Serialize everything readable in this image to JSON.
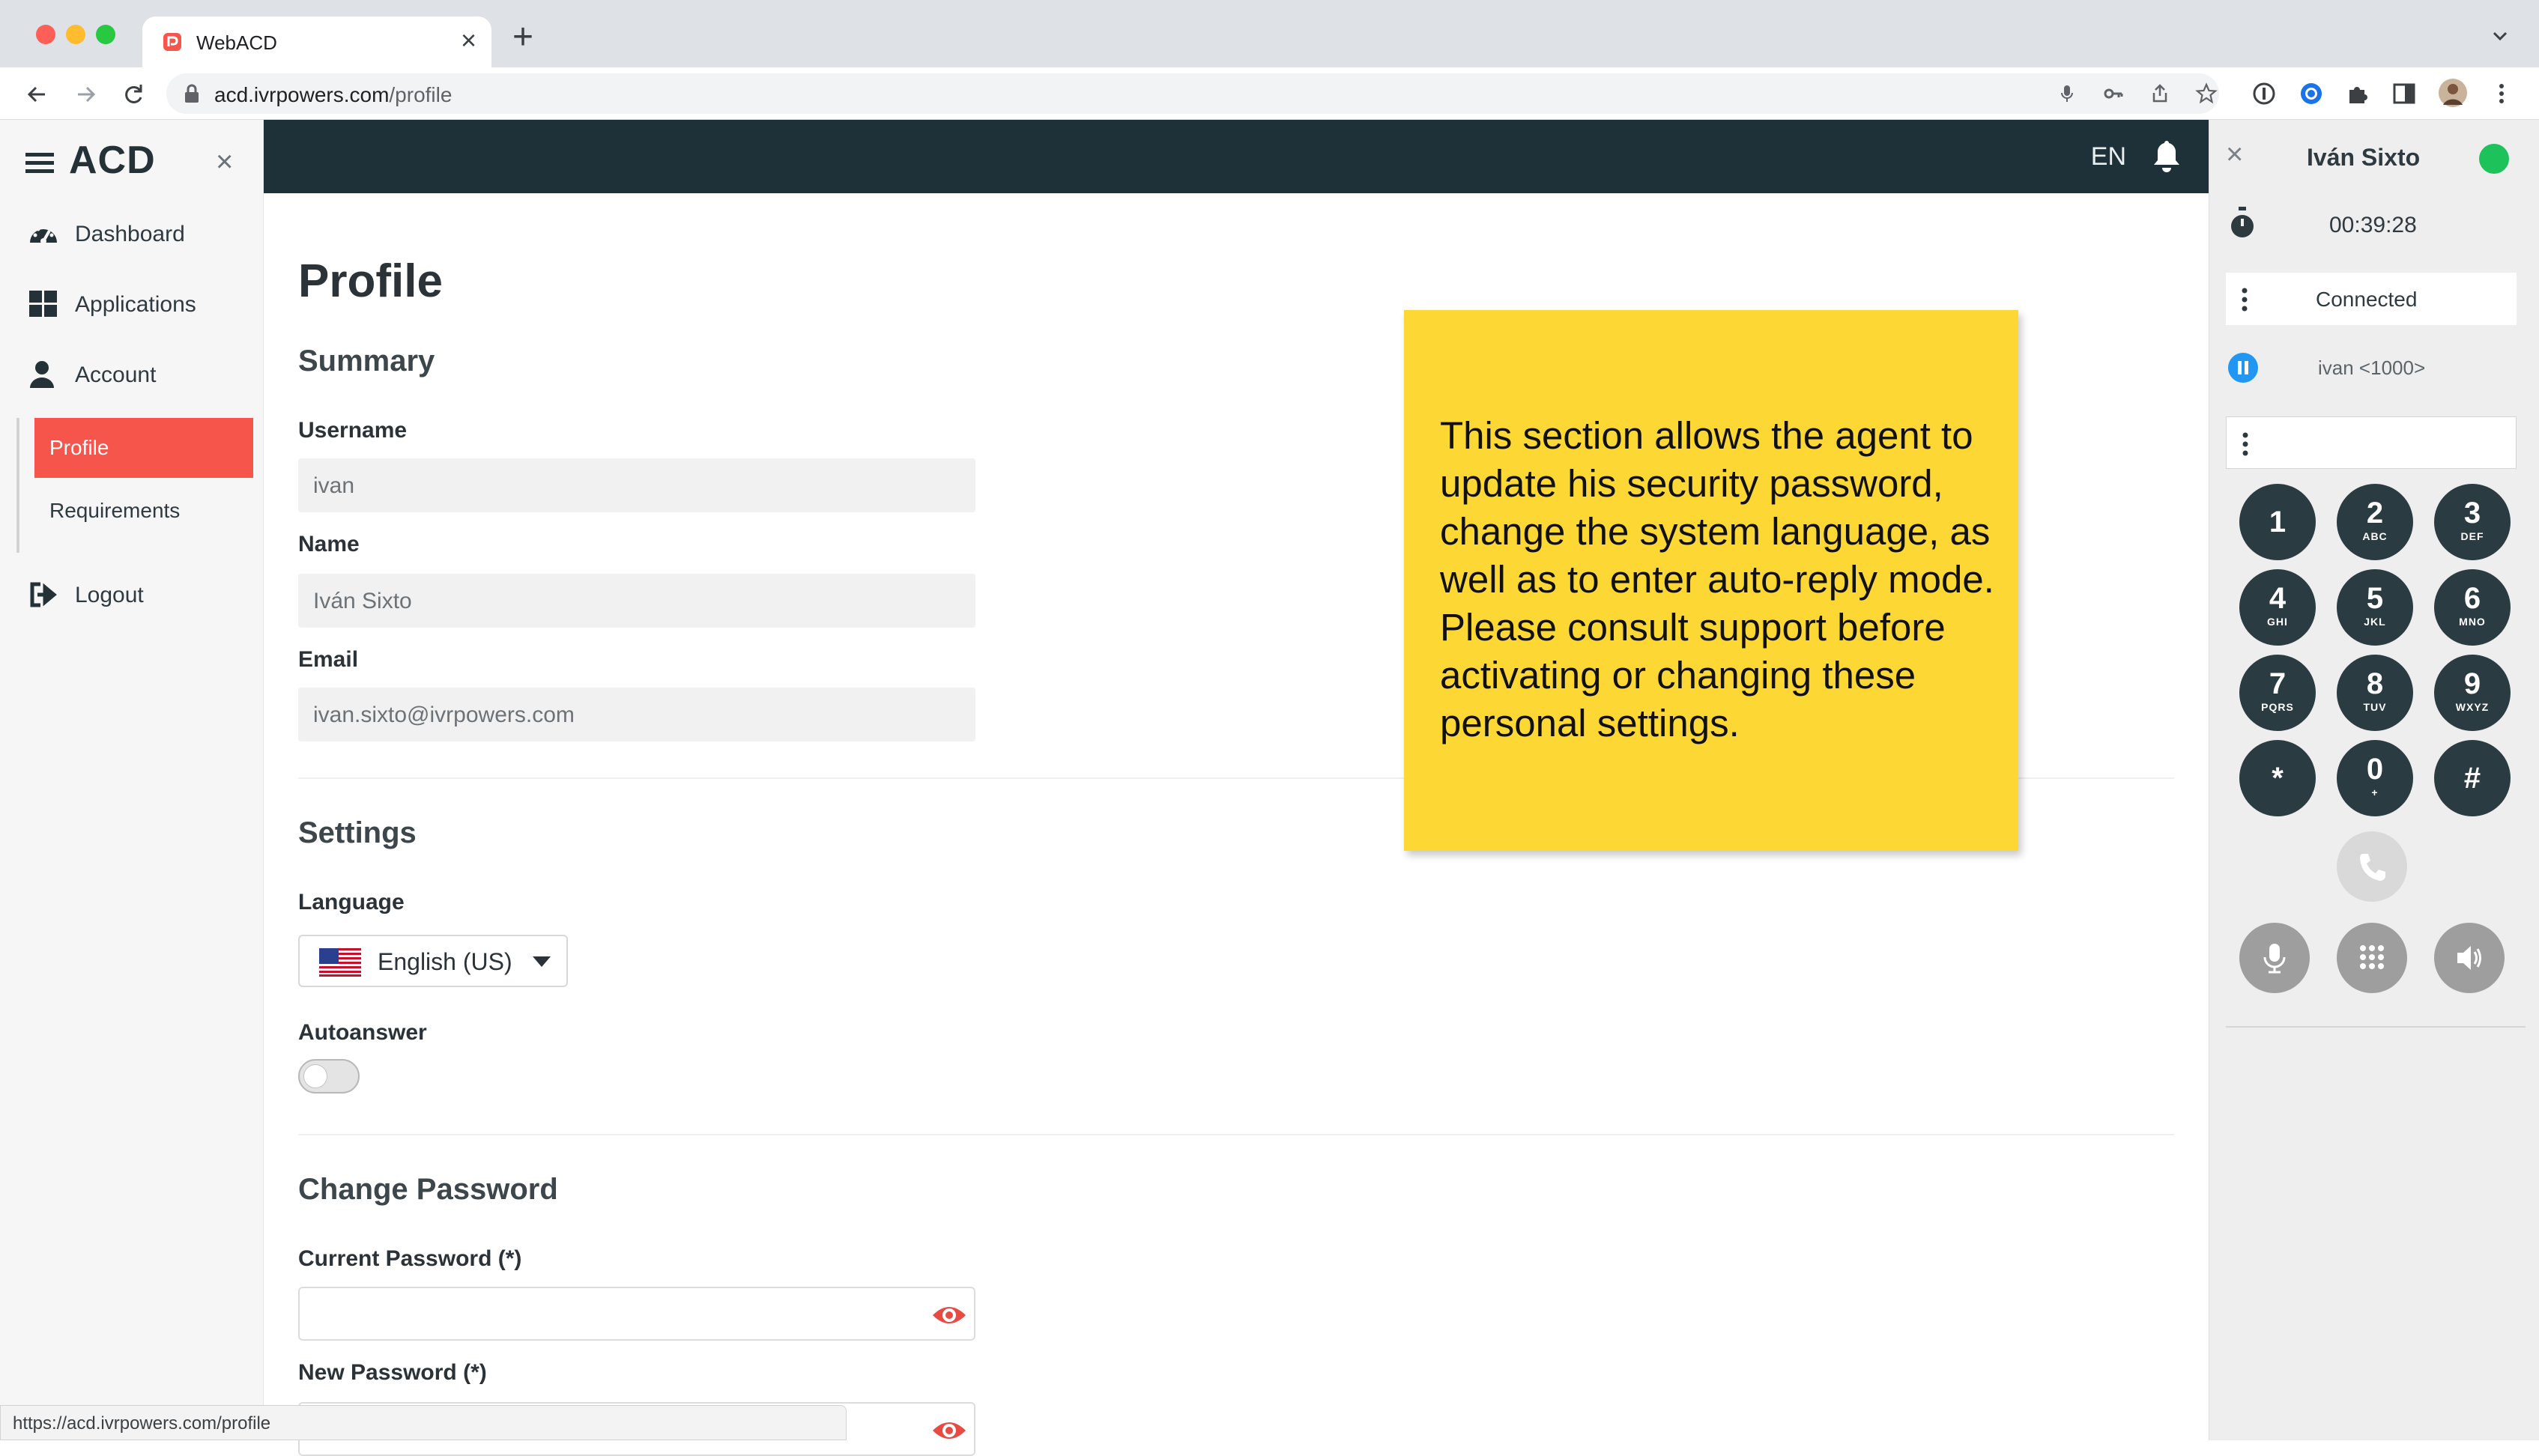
{
  "browser": {
    "tab_title": "WebACD",
    "url_domain": "acd.ivrpowers.com",
    "url_path": "/profile",
    "status_url": "https://acd.ivrpowers.com/profile"
  },
  "sidebar": {
    "logo": "ACD",
    "items": [
      {
        "label": "Dashboard",
        "icon": "dashboard-icon"
      },
      {
        "label": "Applications",
        "icon": "grid-icon"
      },
      {
        "label": "Account",
        "icon": "user-icon"
      },
      {
        "label": "Logout",
        "icon": "logout-icon"
      }
    ],
    "account_sub": [
      {
        "label": "Profile",
        "active": true
      },
      {
        "label": "Requirements",
        "active": false
      }
    ],
    "accent_color": "#f5554b"
  },
  "header": {
    "language_code": "EN",
    "bg_color": "#1f3138"
  },
  "profile": {
    "title": "Profile",
    "summary": {
      "heading": "Summary",
      "username_label": "Username",
      "username_value": "ivan",
      "name_label": "Name",
      "name_value": "Iván Sixto",
      "email_label": "Email",
      "email_value": "ivan.sixto@ivrpowers.com"
    },
    "settings": {
      "heading": "Settings",
      "language_label": "Language",
      "language_value": "English (US)",
      "autoanswer_label": "Autoanswer",
      "autoanswer_on": false
    },
    "password": {
      "heading": "Change Password",
      "current_label": "Current Password (*)",
      "new_label": "New Password (*)"
    }
  },
  "note": {
    "text": "This section allows the agent to update his security password, change the system language, as well as to enter auto-reply mode. Please consult support before activating or changing these personal settings.",
    "color": "#fdd835"
  },
  "softphone": {
    "user": "Iván Sixto",
    "presence_color": "#1ec25a",
    "timer": "00:39:28",
    "status": "Connected",
    "call_party": "ivan <1000>",
    "keypad": [
      {
        "digit": "1",
        "letters": ""
      },
      {
        "digit": "2",
        "letters": "ABC"
      },
      {
        "digit": "3",
        "letters": "DEF"
      },
      {
        "digit": "4",
        "letters": "GHI"
      },
      {
        "digit": "5",
        "letters": "JKL"
      },
      {
        "digit": "6",
        "letters": "MNO"
      },
      {
        "digit": "7",
        "letters": "PQRS"
      },
      {
        "digit": "8",
        "letters": "TUV"
      },
      {
        "digit": "9",
        "letters": "WXYZ"
      },
      {
        "digit": "*",
        "letters": ""
      },
      {
        "digit": "0",
        "letters": "+"
      },
      {
        "digit": "#",
        "letters": ""
      }
    ],
    "controls": [
      "call-icon",
      "microphone-icon",
      "keypad-icon",
      "speaker-icon"
    ]
  }
}
